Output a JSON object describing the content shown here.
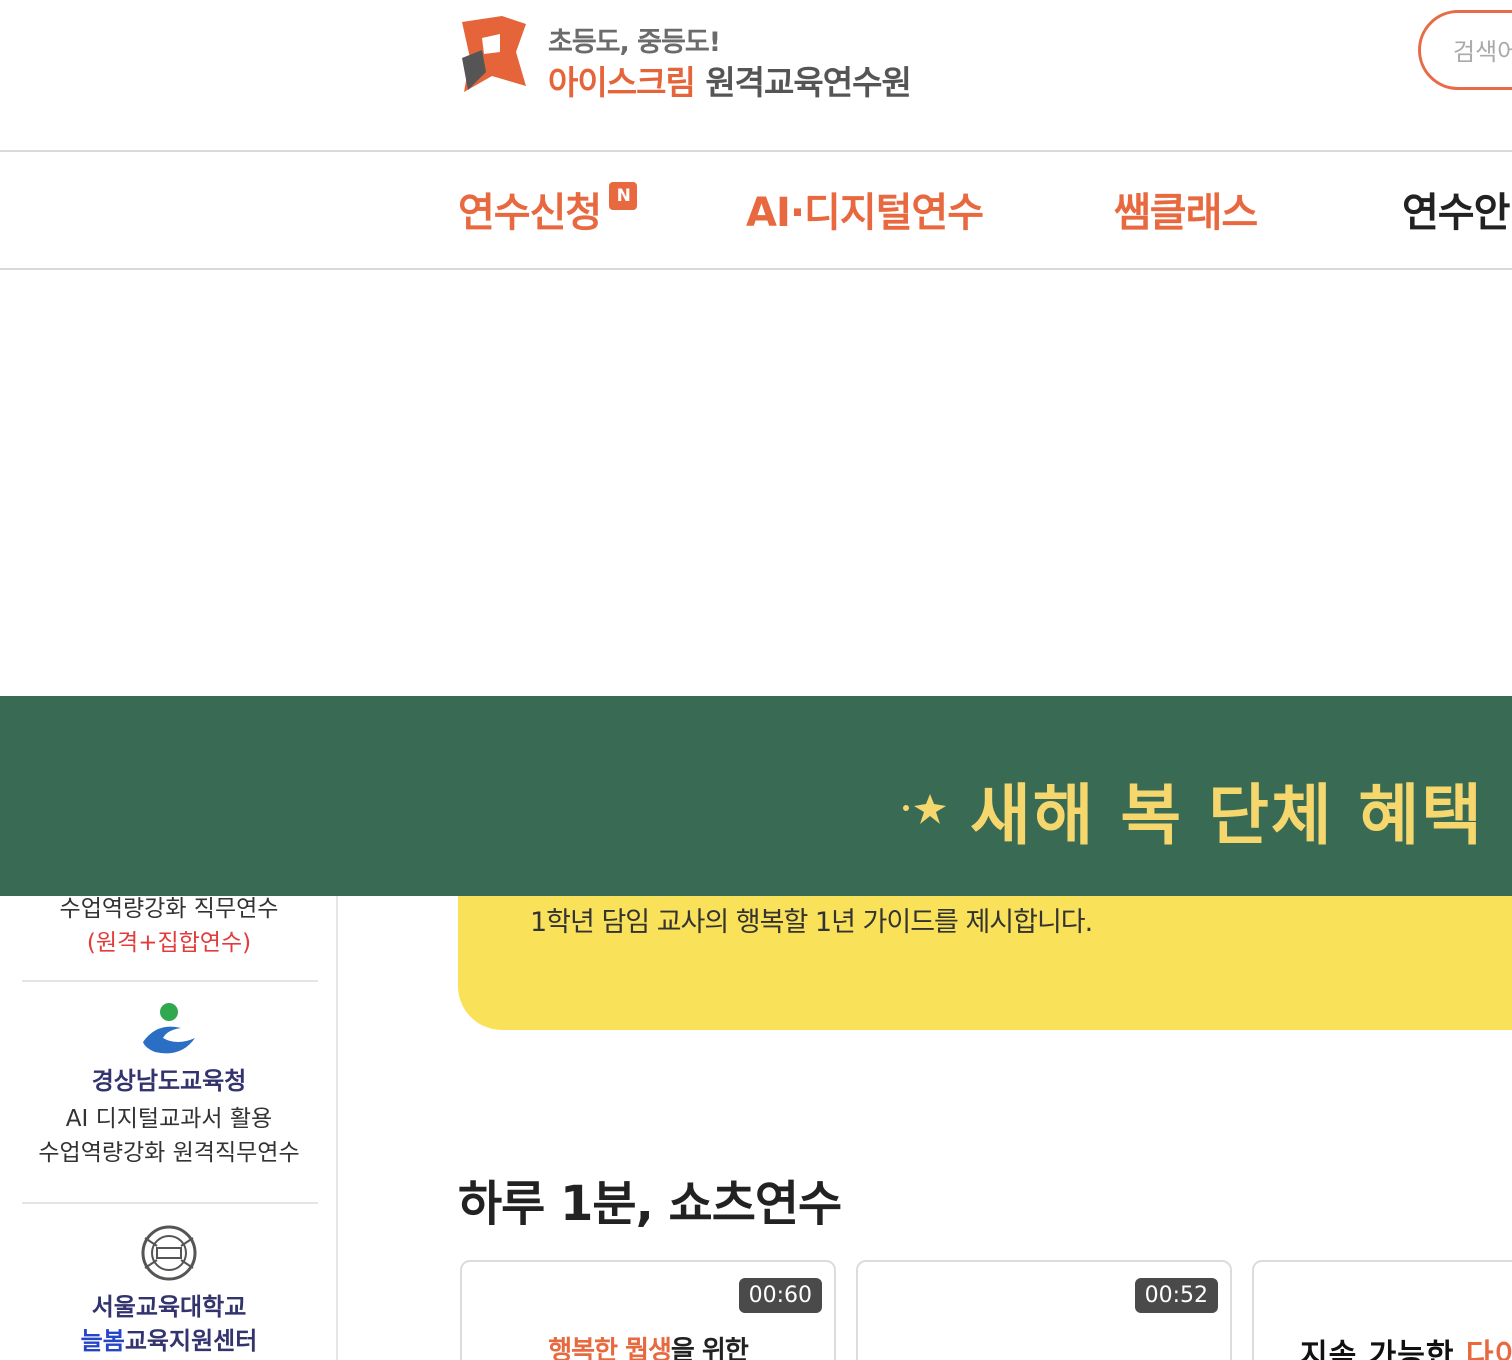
{
  "header": {
    "logo_tagline": "초등도, 중등도!",
    "logo_brand": "아이스크림",
    "logo_rest": "원격교육연수원",
    "search_placeholder": "검색어"
  },
  "colors": {
    "accent": "#e8693f",
    "band_green": "#396b54",
    "banner_yellow": "#f9e25a"
  },
  "nav": {
    "items": [
      {
        "label": "연수신청",
        "badge": "N"
      },
      {
        "label": "AI·디지털연수"
      },
      {
        "label": "쌤클래스"
      },
      {
        "label": "연수안내"
      }
    ]
  },
  "promo_band": {
    "text": "새해 복 단체 혜택 (",
    "icon": "sparkle-star-icon"
  },
  "banner": {
    "text": "1학년 담임 교사의 행복할 1년 가이드를 제시합니다."
  },
  "sidebar": {
    "block1": {
      "line1": "수업역량강화 직무연수",
      "line2": "(원격+집합연수)"
    },
    "block2": {
      "title": "경상남도교육청",
      "line1": "AI 디지털교과서 활용",
      "line2": "수업역량강화 원격직무연수",
      "icon": "gyeongnam-edu-logo-icon"
    },
    "block3": {
      "title": "서울교육대학교",
      "title2_blue": "늘봄",
      "title2_rest": "교육지원센터",
      "icon": "seoul-edu-univ-seal-icon"
    }
  },
  "shorts": {
    "title": "하루 1분, 쇼츠연수",
    "cards": [
      {
        "duration": "00:60",
        "title_hl1": "행복한",
        "title_hl2": "뭡생",
        "title_rest1": " ",
        "title_rest2": "을 위한"
      },
      {
        "duration": "00:52"
      },
      {
        "title_pre": "지속 가능한 ",
        "title_hl": "다이"
      }
    ]
  }
}
